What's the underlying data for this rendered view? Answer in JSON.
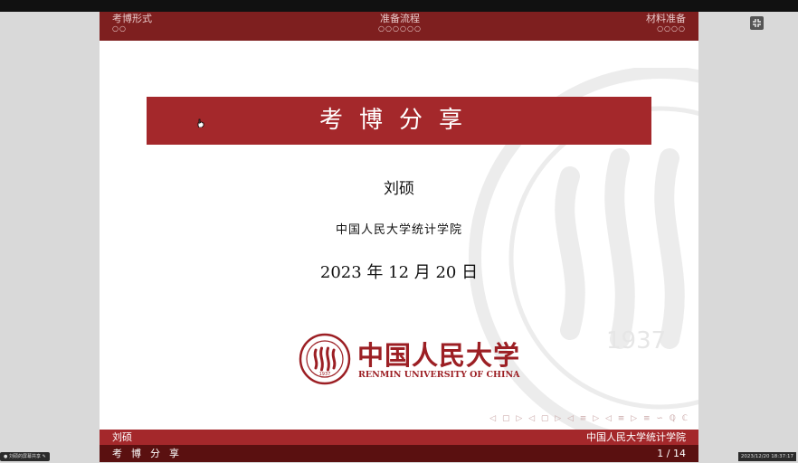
{
  "header": {
    "sections": [
      {
        "label": "考博形式",
        "dots": "○○"
      },
      {
        "label": "准备流程",
        "dots": "○○○○○○"
      },
      {
        "label": "材料准备",
        "dots": "○○○○"
      }
    ]
  },
  "title": "考博分享",
  "author": "刘硕",
  "institute": "中国人民大学统计学院",
  "date": "2023 年 12 月 20 日",
  "logo": {
    "cn": "中国人民大学",
    "en": "RENMIN UNIVERSITY OF CHINA",
    "year": "1937"
  },
  "nav_symbols": "◁ ▢ ▷ ◁ ▢ ▷ ◁ ≡ ▷ ◁ ≡ ▷ ≡ ∽ ℚ ℂ",
  "footer": {
    "author": "刘硕",
    "institute": "中国人民大学统计学院",
    "short_title": "考博分享",
    "page": "1 / 14"
  },
  "overlay": {
    "bottom_left_label": "刘硕的屏幕共享",
    "timestamp": "2023/12/20 18:37:17"
  },
  "colors": {
    "header_bg": "#7e1f1f",
    "title_bar": "#a4282b",
    "footer_dark": "#5a1010",
    "logo_red": "#9c1f24"
  },
  "icons": {
    "fullscreen": "exit-fullscreen-icon",
    "cursor": "hand-cursor-icon",
    "mic": "microphone-icon",
    "edit": "pencil-icon"
  }
}
